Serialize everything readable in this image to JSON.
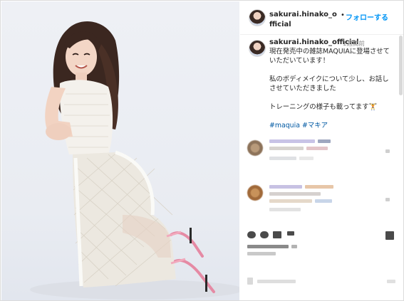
{
  "post": {
    "username": "sakurai.hinako_official",
    "follow_separator": "•",
    "follow_label": "フォローする",
    "photo_alt": "Woman kneeling in white knit top and fishnet skirt with pink heels",
    "caption": {
      "username": "sakurai.hinako_official",
      "time": "1週間前",
      "line1": "現在発売中の雑誌MAQUIAに登場させていただいています！",
      "line2": "私のボディメイクについて少し、お話しさせていただきました",
      "line3": "トレーニングの様子も載ってます🏋",
      "hashtags": [
        "#maquia",
        "#マキア"
      ]
    }
  },
  "colors": {
    "link": "#0095f6",
    "hashtag": "#00376b",
    "meta": "#8e8e8e",
    "border": "#dbdbdb"
  }
}
